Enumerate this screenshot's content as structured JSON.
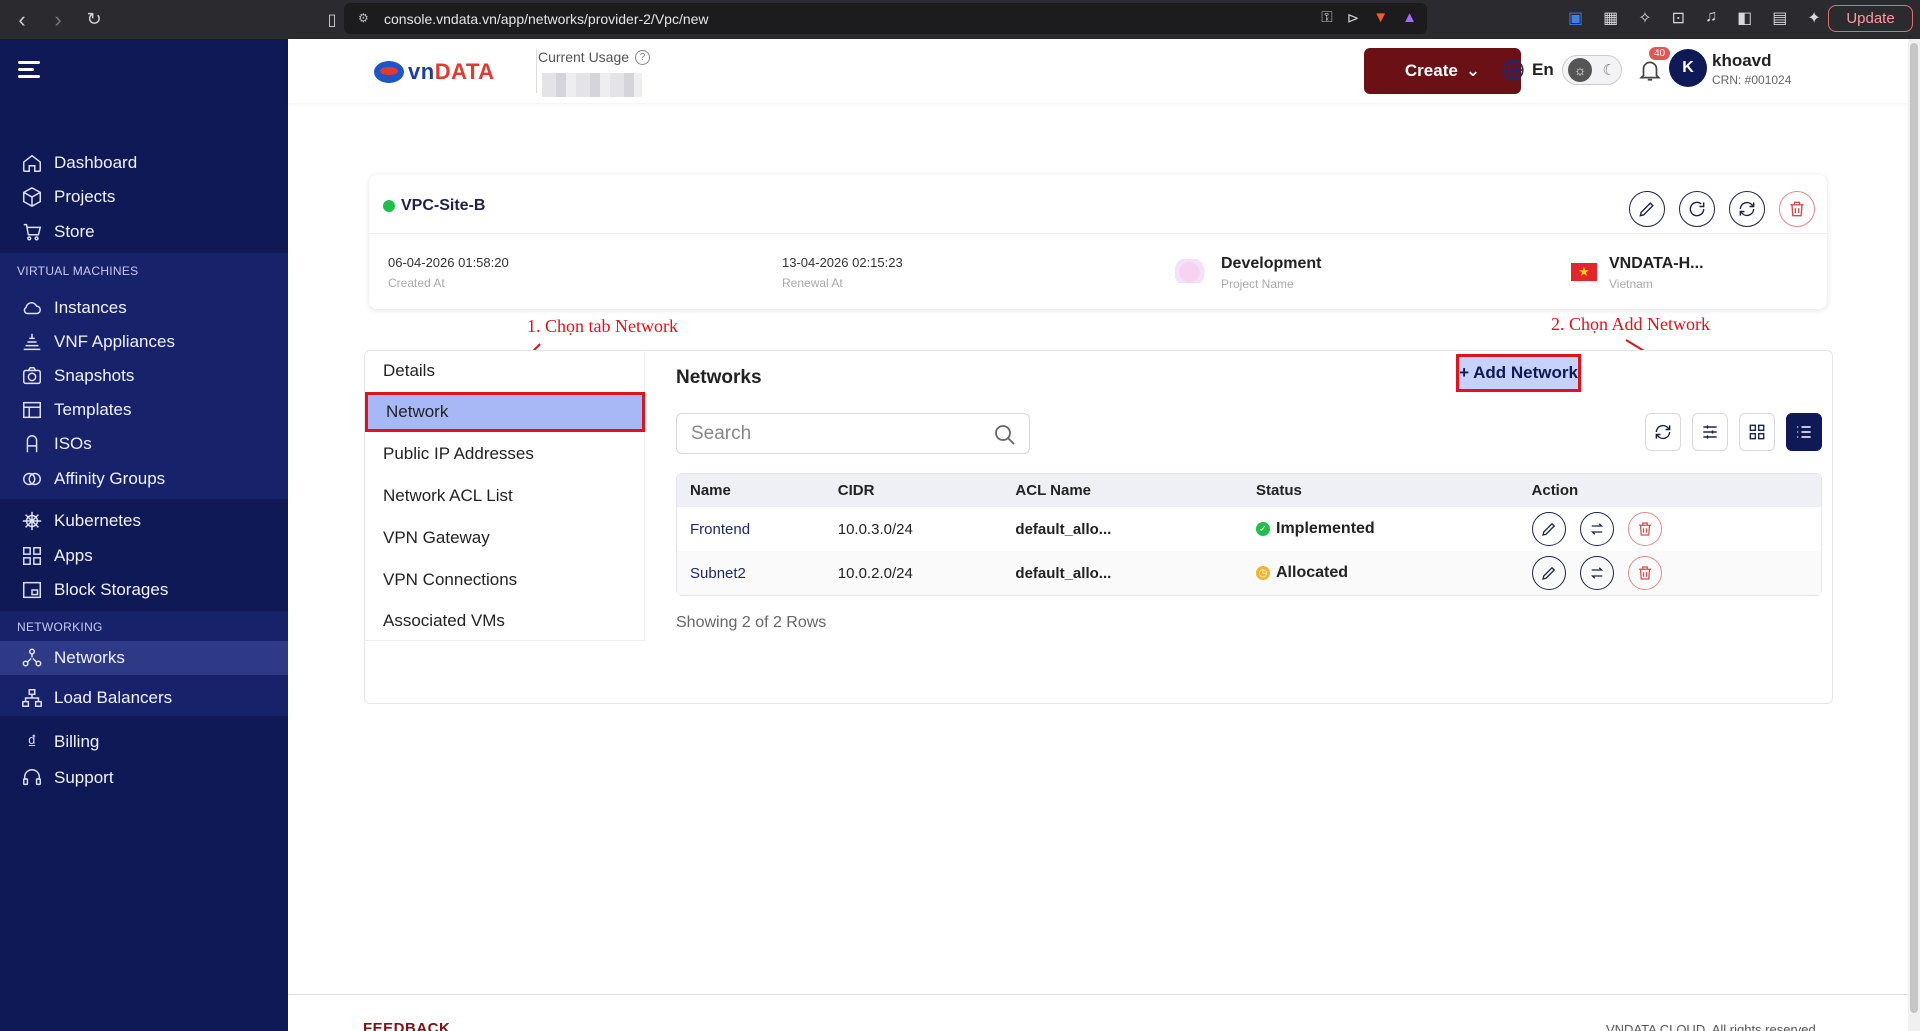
{
  "browser": {
    "url": "console.vndata.vn/app/networks/provider-2/Vpc/new",
    "update_label": "Update"
  },
  "sidebar": {
    "main_items": [
      {
        "label": "Dashboard",
        "icon": "home-icon"
      },
      {
        "label": "Projects",
        "icon": "cube-icon"
      },
      {
        "label": "Store",
        "icon": "cart-icon"
      }
    ],
    "vm_section": "VIRTUAL MACHINES",
    "vm_items": [
      {
        "label": "Instances",
        "icon": "cloud-icon"
      },
      {
        "label": "VNF Appliances",
        "icon": "firewall-icon"
      },
      {
        "label": "Snapshots",
        "icon": "camera-icon"
      },
      {
        "label": "Templates",
        "icon": "template-icon"
      },
      {
        "label": "ISOs",
        "icon": "iso-icon"
      },
      {
        "label": "Affinity Groups",
        "icon": "affinity-icon"
      }
    ],
    "other_items": [
      {
        "label": "Kubernetes",
        "icon": "helm-icon"
      },
      {
        "label": "Apps",
        "icon": "grid-icon"
      },
      {
        "label": "Block Storages",
        "icon": "storage-icon"
      }
    ],
    "net_section": "NETWORKING",
    "net_items": [
      {
        "label": "Networks",
        "icon": "network-icon",
        "active": true
      },
      {
        "label": "Load Balancers",
        "icon": "balancer-icon"
      }
    ],
    "bottom_items": [
      {
        "label": "Billing",
        "icon": "dong-icon"
      },
      {
        "label": "Support",
        "icon": "headset-icon"
      }
    ]
  },
  "header": {
    "logo_text_blue": "vn",
    "logo_text_red": "DATA",
    "usage_label": "Current Usage",
    "create_label": "Create",
    "language": "En",
    "notification_count": "40",
    "avatar_letter": "K",
    "user_name": "khoavd",
    "user_crn": "CRN: #001024"
  },
  "vpc": {
    "name": "VPC-Site-B",
    "status_color": "#1fbf4a",
    "created_at": "06-04-2026 01:58:20",
    "created_label": "Created At",
    "renewal_at": "13-04-2026 02:15:23",
    "renewal_label": "Renewal At",
    "project_name": "Development",
    "project_label": "Project Name",
    "region_name": "VNDATA-H...",
    "region_country": "Vietnam"
  },
  "annotations": {
    "step1": "1. Chọn tab Network",
    "step2": "2. Chọn Add Network"
  },
  "tabs": [
    {
      "label": "Details"
    },
    {
      "label": "Network",
      "active": true
    },
    {
      "label": "Public IP Addresses"
    },
    {
      "label": "Network ACL List"
    },
    {
      "label": "VPN Gateway"
    },
    {
      "label": "VPN Connections"
    },
    {
      "label": "Associated VMs"
    }
  ],
  "networks": {
    "title": "Networks",
    "add_label": "+ Add Network",
    "search_placeholder": "Search",
    "columns": [
      "Name",
      "CIDR",
      "ACL Name",
      "Status",
      "Action"
    ],
    "rows": [
      {
        "name": "Frontend",
        "cidr": "10.0.3.0/24",
        "acl": "default_allo...",
        "status": "Implemented",
        "status_color": "#1fbf4a"
      },
      {
        "name": "Subnet2",
        "cidr": "10.0.2.0/24",
        "acl": "default_allo...",
        "status": "Allocated",
        "status_color": "#f2b52c"
      }
    ],
    "rows_count": "Showing 2 of 2 Rows"
  },
  "footer": {
    "left": "FEEDBACK",
    "right": "VNDATA CLOUD. All rights reserved"
  }
}
